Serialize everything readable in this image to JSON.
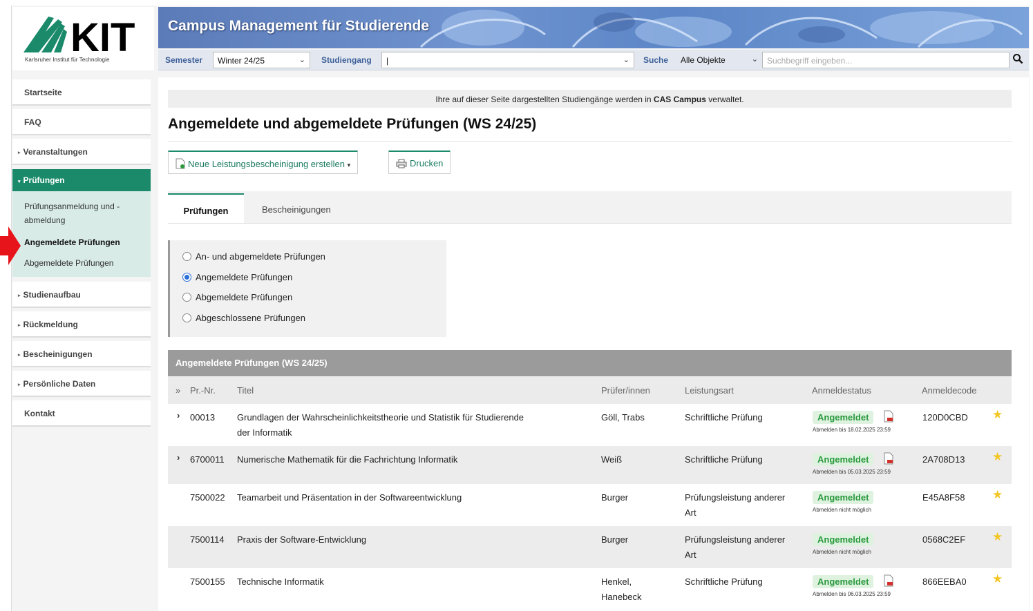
{
  "logo": {
    "text": "KIT",
    "subtitle": "Karlsruher Institut für Technologie"
  },
  "banner": {
    "title": "Campus Management für Studierende"
  },
  "searchbar": {
    "semester_label": "Semester",
    "semester_value": "Winter 24/25",
    "studiengang_label": "Studiengang",
    "studiengang_value": "|",
    "suche_label": "Suche",
    "suche_value": "Alle Objekte",
    "search_placeholder": "Suchbegriff eingeben..."
  },
  "sidebar": {
    "items": [
      {
        "label": "Startseite"
      },
      {
        "label": "FAQ"
      },
      {
        "label": "Veranstaltungen"
      },
      {
        "label": "Prüfungen"
      },
      {
        "label": "Studienaufbau"
      },
      {
        "label": "Rückmeldung"
      },
      {
        "label": "Bescheinigungen"
      },
      {
        "label": "Persönliche Daten"
      },
      {
        "label": "Kontakt"
      }
    ],
    "sub_items": [
      {
        "label": "Prüfungsanmeldung und -abmeldung"
      },
      {
        "label": "Angemeldete Prüfungen"
      },
      {
        "label": "Abgemeldete Prüfungen"
      }
    ]
  },
  "notice": {
    "pre": "Ihre auf dieser Seite dargestellten Studiengänge werden in ",
    "bold": "CAS Campus",
    "post": " verwaltet."
  },
  "page_title": "Angemeldete und abgemeldete Prüfungen (WS 24/25)",
  "buttons": {
    "new_certificate": "Neue Leistungsbescheinigung erstellen",
    "print": "Drucken"
  },
  "tabs": [
    {
      "label": "Prüfungen"
    },
    {
      "label": "Bescheinigungen"
    }
  ],
  "filter": [
    {
      "label": "An- und abgemeldete Prüfungen"
    },
    {
      "label": "Angemeldete Prüfungen"
    },
    {
      "label": "Abgemeldete Prüfungen"
    },
    {
      "label": "Abgeschlossene Prüfungen"
    }
  ],
  "table": {
    "title": "Angemeldete Prüfungen (WS 24/25)",
    "columns": [
      "Pr.-Nr.",
      "Titel",
      "Prüfer/innen",
      "Leistungsart",
      "Anmeldestatus",
      "Anmeldecode"
    ],
    "expand_all": "»",
    "rows": [
      {
        "nr": "00013",
        "title1": "Grundlagen der Wahrscheinlichkeitstheorie und Statistik für Studierende",
        "title2": "der Informatik",
        "examiner1": "Göll, Trabs",
        "examiner2": "",
        "type1": "Schriftliche Prüfung",
        "type2": "",
        "status": "Angemeldet",
        "deadline": "Abmelden bis 18.02.2025 23:59",
        "code": "120D0CBD"
      },
      {
        "nr": "6700011",
        "title1": "Numerische Mathematik für die Fachrichtung Informatik",
        "title2": "",
        "examiner1": "Weiß",
        "examiner2": "",
        "type1": "Schriftliche Prüfung",
        "type2": "",
        "status": "Angemeldet",
        "deadline": "Abmelden bis 05.03.2025 23:59",
        "code": "2A708D13"
      },
      {
        "nr": "7500022",
        "title1": "Teamarbeit und Präsentation in der Softwareentwicklung",
        "title2": "",
        "examiner1": "Burger",
        "examiner2": "",
        "type1": "Prüfungsleistung anderer",
        "type2": "Art",
        "status": "Angemeldet",
        "deadline": "Abmelden nicht möglich",
        "code": "E45A8F58"
      },
      {
        "nr": "7500114",
        "title1": "Praxis der Software-Entwicklung",
        "title2": "",
        "examiner1": "Burger",
        "examiner2": "",
        "type1": "Prüfungsleistung anderer",
        "type2": "Art",
        "status": "Angemeldet",
        "deadline": "Abmelden nicht möglich",
        "code": "0568C2EF"
      },
      {
        "nr": "7500155",
        "title1": "Technische Informatik",
        "title2": "",
        "examiner1": "Henkel,",
        "examiner2": "Hanebeck",
        "type1": "Schriftliche Prüfung",
        "type2": "",
        "status": "Angemeldet",
        "deadline": "Abmelden bis 06.03.2025 23:59",
        "code": "866EEBA0"
      }
    ]
  },
  "colors": {
    "kit_green": "#1a8a6a",
    "badge_green": "#2a9a3e",
    "banner_blue": "#5b7bb8",
    "arrow_red": "#e8141b"
  }
}
